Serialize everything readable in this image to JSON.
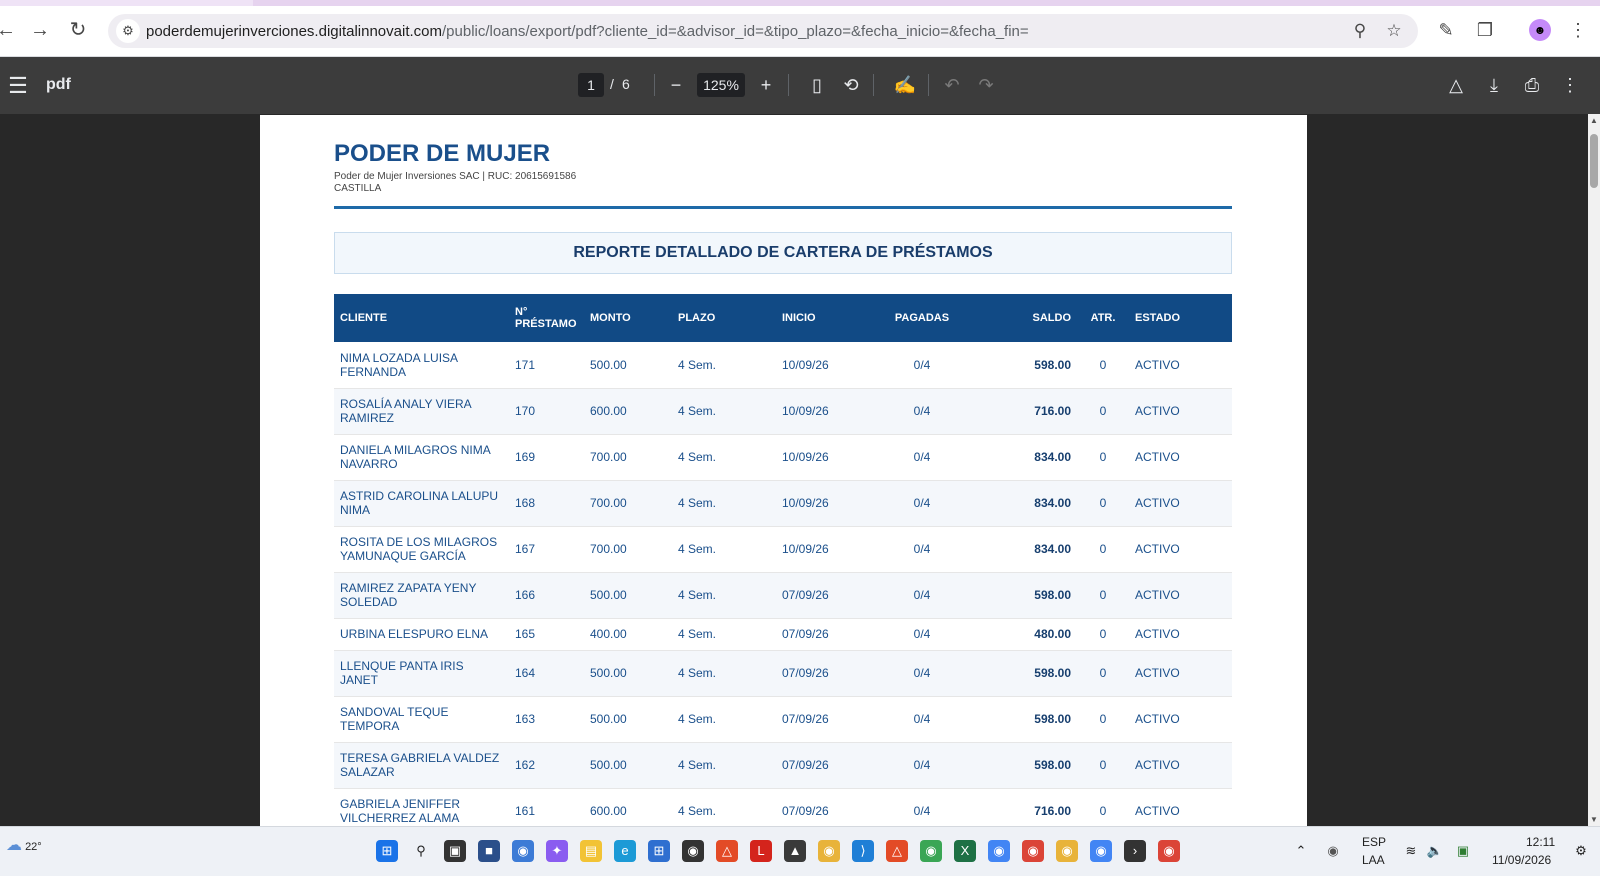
{
  "browser": {
    "url_host": "poderdemujerinverciones.digitalinnovait.com",
    "url_path": "/public/loans/export/pdf?cliente_id=&advisor_id=&tipo_plazo=&fecha_inicio=&fecha_fin="
  },
  "pdf_toolbar": {
    "title": "pdf",
    "current_page": "1",
    "separator": "/",
    "total_pages": "6",
    "zoom": "125%"
  },
  "document": {
    "brand": "PODER DE MUJER",
    "company_line": "Poder de Mujer Inversiones SAC | RUC: 20615691586",
    "city": "CASTILLA",
    "report_title": "REPORTE DETALLADO DE CARTERA DE PRÉSTAMOS",
    "columns": {
      "cliente": "CLIENTE",
      "nro_a": "N°",
      "nro_b": "PRÉSTAMO",
      "monto": "MONTO",
      "plazo": "PLAZO",
      "inicio": "INICIO",
      "pagadas": "PAGADAS",
      "saldo": "SALDO",
      "atr": "ATR.",
      "estado": "ESTADO"
    },
    "rows": [
      {
        "cliente_1": "NIMA LOZADA LUISA",
        "cliente_2": "FERNANDA",
        "nro": "171",
        "monto": "500.00",
        "plazo": "4 Sem.",
        "inicio": "10/09/26",
        "pagadas": "0/4",
        "saldo": "598.00",
        "atr": "0",
        "estado": "ACTIVO"
      },
      {
        "cliente_1": "ROSALÍA ANALY VIERA",
        "cliente_2": "RAMIREZ",
        "nro": "170",
        "monto": "600.00",
        "plazo": "4 Sem.",
        "inicio": "10/09/26",
        "pagadas": "0/4",
        "saldo": "716.00",
        "atr": "0",
        "estado": "ACTIVO"
      },
      {
        "cliente_1": "DANIELA MILAGROS NIMA",
        "cliente_2": "NAVARRO",
        "nro": "169",
        "monto": "700.00",
        "plazo": "4 Sem.",
        "inicio": "10/09/26",
        "pagadas": "0/4",
        "saldo": "834.00",
        "atr": "0",
        "estado": "ACTIVO"
      },
      {
        "cliente_1": "ASTRID CAROLINA LALUPU",
        "cliente_2": "NIMA",
        "nro": "168",
        "monto": "700.00",
        "plazo": "4 Sem.",
        "inicio": "10/09/26",
        "pagadas": "0/4",
        "saldo": "834.00",
        "atr": "0",
        "estado": "ACTIVO"
      },
      {
        "cliente_1": "ROSITA DE LOS MILAGROS",
        "cliente_2": "YAMUNAQUE GARCÍA",
        "nro": "167",
        "monto": "700.00",
        "plazo": "4 Sem.",
        "inicio": "10/09/26",
        "pagadas": "0/4",
        "saldo": "834.00",
        "atr": "0",
        "estado": "ACTIVO"
      },
      {
        "cliente_1": "RAMIREZ ZAPATA YENY",
        "cliente_2": "SOLEDAD",
        "nro": "166",
        "monto": "500.00",
        "plazo": "4 Sem.",
        "inicio": "07/09/26",
        "pagadas": "0/4",
        "saldo": "598.00",
        "atr": "0",
        "estado": "ACTIVO"
      },
      {
        "cliente_1": "URBINA ELESPURO ELNA",
        "cliente_2": "",
        "nro": "165",
        "monto": "400.00",
        "plazo": "4 Sem.",
        "inicio": "07/09/26",
        "pagadas": "0/4",
        "saldo": "480.00",
        "atr": "0",
        "estado": "ACTIVO"
      },
      {
        "cliente_1": "LLENQUE PANTA IRIS",
        "cliente_2": "JANET",
        "nro": "164",
        "monto": "500.00",
        "plazo": "4 Sem.",
        "inicio": "07/09/26",
        "pagadas": "0/4",
        "saldo": "598.00",
        "atr": "0",
        "estado": "ACTIVO"
      },
      {
        "cliente_1": "SANDOVAL TEQUE",
        "cliente_2": "TEMPORA",
        "nro": "163",
        "monto": "500.00",
        "plazo": "4 Sem.",
        "inicio": "07/09/26",
        "pagadas": "0/4",
        "saldo": "598.00",
        "atr": "0",
        "estado": "ACTIVO"
      },
      {
        "cliente_1": "TERESA GABRIELA VALDEZ",
        "cliente_2": "SALAZAR",
        "nro": "162",
        "monto": "500.00",
        "plazo": "4 Sem.",
        "inicio": "07/09/26",
        "pagadas": "0/4",
        "saldo": "598.00",
        "atr": "0",
        "estado": "ACTIVO"
      },
      {
        "cliente_1": "GABRIELA JENIFFER",
        "cliente_2": "VILCHERREZ ALAMA",
        "nro": "161",
        "monto": "600.00",
        "plazo": "4 Sem.",
        "inicio": "07/09/26",
        "pagadas": "0/4",
        "saldo": "716.00",
        "atr": "0",
        "estado": "ACTIVO"
      }
    ]
  },
  "taskbar": {
    "temperature": "22°",
    "language_1": "ESP",
    "language_2": "LAA",
    "time": "12:11",
    "date": "11/09/2026"
  },
  "colors": {
    "brand_blue": "#1a4f8b",
    "table_header": "#114a85",
    "rule": "#1e6aa8",
    "pdf_toolbar": "#3c3c3c"
  },
  "icons": {
    "back": "arrow-left-icon",
    "forward": "arrow-right-icon",
    "reload": "reload-icon",
    "site_info": "tune-icon",
    "zoom": "magnifier-icon",
    "bookmark": "star-icon",
    "extensions": "puzzle-icon",
    "more": "kebab-icon"
  }
}
